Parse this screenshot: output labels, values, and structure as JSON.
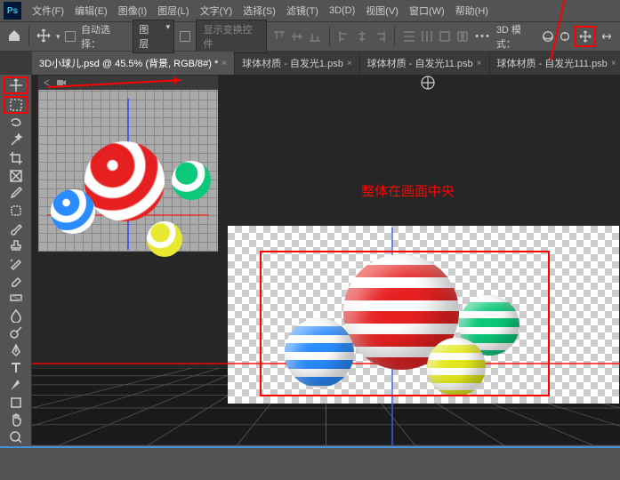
{
  "menu": {
    "items": [
      "文件(F)",
      "编辑(E)",
      "图像(I)",
      "图层(L)",
      "文字(Y)",
      "选择(S)",
      "滤镜(T)",
      "3D(D)",
      "视图(V)",
      "窗口(W)",
      "帮助(H)"
    ]
  },
  "optbar": {
    "auto_select": "自动选择：",
    "layer_dd": "图层",
    "transform_controls": "显示变换控件",
    "mode3d_label": "3D 模式："
  },
  "tabs": [
    {
      "label": "3D小球儿.psd @ 45.5% (背景, RGB/8#) *",
      "active": true
    },
    {
      "label": "球体材质 - 自发光1.psb",
      "active": false
    },
    {
      "label": "球体材质 - 自发光11.psb",
      "active": false
    },
    {
      "label": "球体材质 - 自发光111.psb",
      "active": false
    }
  ],
  "annotation": {
    "center_label": "整体在画面中央"
  }
}
